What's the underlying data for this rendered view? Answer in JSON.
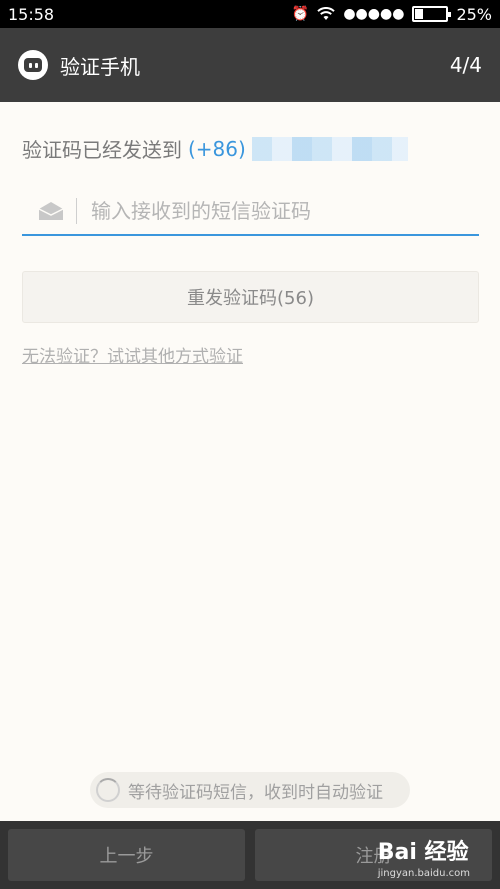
{
  "status_bar": {
    "time": "15:58",
    "signal": "●●●●●",
    "battery_text": "25%",
    "battery_level": 0.25
  },
  "header": {
    "title": "验证手机",
    "step": "4/4"
  },
  "verification": {
    "sent_text": "验证码已经发送到",
    "country_code": "(+86)",
    "input_placeholder": "输入接收到的短信验证码",
    "resend_label": "重发验证码(56)",
    "alt_link": "无法验证？试试其他方式验证",
    "waiting_text": "等待验证码短信，收到时自动验证"
  },
  "bottom": {
    "prev_label": "上一步",
    "next_label": "注册"
  },
  "watermark": {
    "brand": "Bai 经验",
    "url": "jingyan.baidu.com"
  },
  "colors": {
    "accent": "#3a96dd",
    "header_bg": "#3d3d3d",
    "page_bg": "#fdfbf7"
  }
}
